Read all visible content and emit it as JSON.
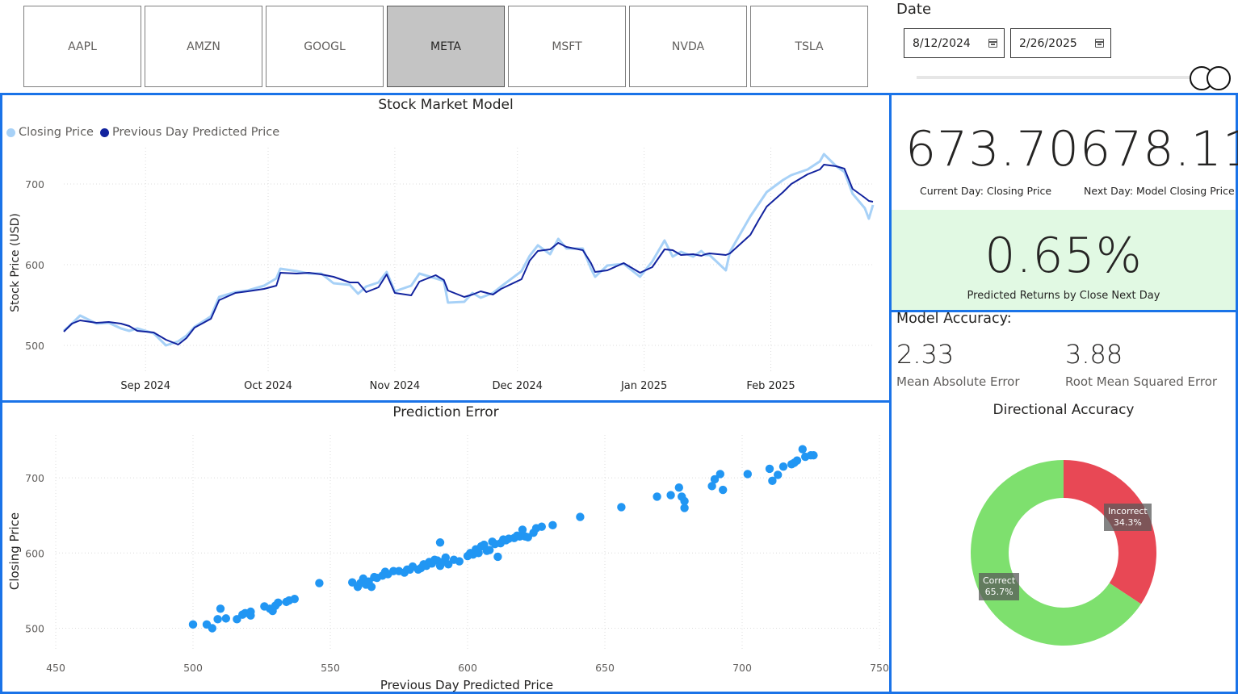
{
  "tickers": {
    "items": [
      "AAPL",
      "AMZN",
      "GOOGL",
      "META",
      "MSFT",
      "NVDA",
      "TSLA"
    ],
    "selected": "META"
  },
  "date_filter": {
    "title": "Date",
    "start": "8/12/2024",
    "end": "2/26/2025"
  },
  "kpi": {
    "current_value": "673.70",
    "current_label": "Current Day: Closing Price",
    "next_value": "678.11",
    "next_label": "Next Day: Model Closing Price",
    "returns_value": "0.65%",
    "returns_label": "Predicted Returns by Close Next Day"
  },
  "accuracy": {
    "title": "Model Accuracy:",
    "mae_value": "2.33",
    "mae_label": "Mean Absolute Error",
    "rmse_value": "3.88",
    "rmse_label": "Root Mean Squared Error"
  },
  "colors": {
    "accent": "#1a73e8",
    "closing": "#a7d1f7",
    "predicted": "#12239e",
    "scatter": "#2196f3",
    "correct": "#7ee06e",
    "incorrect": "#e84855",
    "returns_bg": "#e1f9e3"
  },
  "chart_data": [
    {
      "type": "line",
      "title": "Stock Market Model",
      "xlabel": "",
      "ylabel": "Stock Price (USD)",
      "x_tick_labels": [
        "Sep 2024",
        "Oct 2024",
        "Nov 2024",
        "Dec 2024",
        "Jan 2025",
        "Feb 2025"
      ],
      "y_ticks": [
        500,
        600,
        700
      ],
      "ylim": [
        480,
        745
      ],
      "x_range": [
        "2024-08-12",
        "2025-02-26"
      ],
      "grid": true,
      "legend_position": "top-left",
      "series": [
        {
          "name": "Closing Price",
          "points": [
            [
              "2024-08-12",
              518
            ],
            [
              "2024-08-14",
              527
            ],
            [
              "2024-08-16",
              537
            ],
            [
              "2024-08-20",
              527
            ],
            [
              "2024-08-23",
              528
            ],
            [
              "2024-08-26",
              521
            ],
            [
              "2024-08-28",
              518
            ],
            [
              "2024-08-30",
              521
            ],
            [
              "2024-09-03",
              515
            ],
            [
              "2024-09-06",
              500
            ],
            [
              "2024-09-09",
              505
            ],
            [
              "2024-09-11",
              512
            ],
            [
              "2024-09-13",
              523
            ],
            [
              "2024-09-17",
              536
            ],
            [
              "2024-09-19",
              560
            ],
            [
              "2024-09-23",
              566
            ],
            [
              "2024-09-26",
              568
            ],
            [
              "2024-09-30",
              574
            ],
            [
              "2024-10-03",
              583
            ],
            [
              "2024-10-04",
              595
            ],
            [
              "2024-10-08",
              592
            ],
            [
              "2024-10-11",
              589
            ],
            [
              "2024-10-14",
              589
            ],
            [
              "2024-10-17",
              577
            ],
            [
              "2024-10-21",
              575
            ],
            [
              "2024-10-23",
              564
            ],
            [
              "2024-10-25",
              573
            ],
            [
              "2024-10-28",
              578
            ],
            [
              "2024-10-30",
              591
            ],
            [
              "2024-11-01",
              567
            ],
            [
              "2024-11-05",
              574
            ],
            [
              "2024-11-07",
              589
            ],
            [
              "2024-11-11",
              583
            ],
            [
              "2024-11-13",
              580
            ],
            [
              "2024-11-14",
              553
            ],
            [
              "2024-11-18",
              554
            ],
            [
              "2024-11-20",
              565
            ],
            [
              "2024-11-22",
              559
            ],
            [
              "2024-11-25",
              565
            ],
            [
              "2024-11-27",
              573
            ],
            [
              "2024-12-02",
              592
            ],
            [
              "2024-12-04",
              611
            ],
            [
              "2024-12-06",
              624
            ],
            [
              "2024-12-09",
              613
            ],
            [
              "2024-12-11",
              632
            ],
            [
              "2024-12-13",
              620
            ],
            [
              "2024-12-17",
              620
            ],
            [
              "2024-12-19",
              595
            ],
            [
              "2024-12-20",
              585
            ],
            [
              "2024-12-23",
              599
            ],
            [
              "2024-12-27",
              601
            ],
            [
              "2024-12-31",
              585
            ],
            [
              "2025-01-03",
              604
            ],
            [
              "2025-01-06",
              630
            ],
            [
              "2025-01-08",
              610
            ],
            [
              "2025-01-10",
              616
            ],
            [
              "2025-01-13",
              610
            ],
            [
              "2025-01-15",
              617
            ],
            [
              "2025-01-16",
              612
            ],
            [
              "2025-01-17",
              612
            ],
            [
              "2025-01-21",
              593
            ],
            [
              "2025-01-22",
              616
            ],
            [
              "2025-01-27",
              660
            ],
            [
              "2025-01-29",
              675
            ],
            [
              "2025-01-31",
              690
            ],
            [
              "2025-02-04",
              705
            ],
            [
              "2025-02-06",
              711
            ],
            [
              "2025-02-10",
              718
            ],
            [
              "2025-02-13",
              728
            ],
            [
              "2025-02-14",
              737
            ],
            [
              "2025-02-17",
              722
            ],
            [
              "2025-02-19",
              715
            ],
            [
              "2025-02-21",
              688
            ],
            [
              "2025-02-24",
              670
            ],
            [
              "2025-02-25",
              657
            ],
            [
              "2025-02-26",
              674
            ]
          ]
        },
        {
          "name": "Previous Day Predicted Price",
          "points": [
            [
              "2024-08-12",
              517
            ],
            [
              "2024-08-14",
              527
            ],
            [
              "2024-08-16",
              531
            ],
            [
              "2024-08-20",
              528
            ],
            [
              "2024-08-23",
              529
            ],
            [
              "2024-08-26",
              527
            ],
            [
              "2024-08-28",
              524
            ],
            [
              "2024-08-30",
              518
            ],
            [
              "2024-09-03",
              516
            ],
            [
              "2024-09-06",
              507
            ],
            [
              "2024-09-09",
              501
            ],
            [
              "2024-09-11",
              509
            ],
            [
              "2024-09-13",
              522
            ],
            [
              "2024-09-17",
              533
            ],
            [
              "2024-09-19",
              556
            ],
            [
              "2024-09-23",
              565
            ],
            [
              "2024-09-26",
              567
            ],
            [
              "2024-09-30",
              570
            ],
            [
              "2024-10-03",
              574
            ],
            [
              "2024-10-04",
              590
            ],
            [
              "2024-10-08",
              589
            ],
            [
              "2024-10-11",
              590
            ],
            [
              "2024-10-14",
              588
            ],
            [
              "2024-10-17",
              585
            ],
            [
              "2024-10-21",
              578
            ],
            [
              "2024-10-23",
              578
            ],
            [
              "2024-10-25",
              566
            ],
            [
              "2024-10-28",
              572
            ],
            [
              "2024-10-30",
              588
            ],
            [
              "2024-11-01",
              565
            ],
            [
              "2024-11-05",
              562
            ],
            [
              "2024-11-07",
              579
            ],
            [
              "2024-11-11",
              587
            ],
            [
              "2024-11-13",
              581
            ],
            [
              "2024-11-14",
              568
            ],
            [
              "2024-11-18",
              560
            ],
            [
              "2024-11-20",
              563
            ],
            [
              "2024-11-22",
              567
            ],
            [
              "2024-11-25",
              563
            ],
            [
              "2024-11-27",
              570
            ],
            [
              "2024-12-02",
              582
            ],
            [
              "2024-12-04",
              605
            ],
            [
              "2024-12-06",
              617
            ],
            [
              "2024-12-09",
              619
            ],
            [
              "2024-12-11",
              627
            ],
            [
              "2024-12-13",
              622
            ],
            [
              "2024-12-17",
              618
            ],
            [
              "2024-12-19",
              602
            ],
            [
              "2024-12-20",
              591
            ],
            [
              "2024-12-23",
              593
            ],
            [
              "2024-12-27",
              602
            ],
            [
              "2024-12-31",
              590
            ],
            [
              "2025-01-03",
              597
            ],
            [
              "2025-01-06",
              619
            ],
            [
              "2025-01-08",
              618
            ],
            [
              "2025-01-10",
              612
            ],
            [
              "2025-01-13",
              613
            ],
            [
              "2025-01-15",
              611
            ],
            [
              "2025-01-16",
              613
            ],
            [
              "2025-01-17",
              614
            ],
            [
              "2025-01-21",
              612
            ],
            [
              "2025-01-22",
              614
            ],
            [
              "2025-01-27",
              637
            ],
            [
              "2025-01-29",
              655
            ],
            [
              "2025-01-31",
              672
            ],
            [
              "2025-02-04",
              690
            ],
            [
              "2025-02-06",
              700
            ],
            [
              "2025-02-10",
              712
            ],
            [
              "2025-02-13",
              718
            ],
            [
              "2025-02-14",
              724
            ],
            [
              "2025-02-17",
              722
            ],
            [
              "2025-02-19",
              719
            ],
            [
              "2025-02-21",
              694
            ],
            [
              "2025-02-24",
              683
            ],
            [
              "2025-02-25",
              679
            ],
            [
              "2025-02-26",
              678
            ]
          ]
        }
      ]
    },
    {
      "type": "scatter",
      "title": "Prediction Error",
      "xlabel": "Previous Day Predicted Price",
      "ylabel": "Closing Price",
      "xlim": [
        450,
        750
      ],
      "ylim": [
        478,
        757
      ],
      "x_ticks": [
        450,
        500,
        550,
        600,
        650,
        700,
        750
      ],
      "y_ticks": [
        500,
        600,
        700
      ],
      "grid": true,
      "points": [
        [
          500,
          505
        ],
        [
          505,
          505
        ],
        [
          507,
          500
        ],
        [
          509,
          512
        ],
        [
          510,
          526
        ],
        [
          512,
          513
        ],
        [
          516,
          512
        ],
        [
          518,
          518
        ],
        [
          519,
          520
        ],
        [
          521,
          522
        ],
        [
          521,
          517
        ],
        [
          526,
          529
        ],
        [
          528,
          526
        ],
        [
          529,
          523
        ],
        [
          530,
          530
        ],
        [
          531,
          534
        ],
        [
          534,
          535
        ],
        [
          535,
          537
        ],
        [
          537,
          539
        ],
        [
          546,
          560
        ],
        [
          558,
          561
        ],
        [
          560,
          555
        ],
        [
          561,
          560
        ],
        [
          562,
          566
        ],
        [
          563,
          558
        ],
        [
          564,
          562
        ],
        [
          565,
          555
        ],
        [
          566,
          568
        ],
        [
          567,
          567
        ],
        [
          569,
          570
        ],
        [
          570,
          575
        ],
        [
          571,
          572
        ],
        [
          573,
          576
        ],
        [
          575,
          576
        ],
        [
          577,
          574
        ],
        [
          578,
          578
        ],
        [
          579,
          578
        ],
        [
          580,
          582
        ],
        [
          582,
          578
        ],
        [
          583,
          580
        ],
        [
          584,
          585
        ],
        [
          585,
          583
        ],
        [
          586,
          588
        ],
        [
          587,
          586
        ],
        [
          588,
          591
        ],
        [
          589,
          590
        ],
        [
          590,
          614
        ],
        [
          590,
          583
        ],
        [
          591,
          588
        ],
        [
          592,
          594
        ],
        [
          593,
          585
        ],
        [
          595,
          591
        ],
        [
          597,
          589
        ],
        [
          600,
          596
        ],
        [
          601,
          600
        ],
        [
          602,
          598
        ],
        [
          603,
          605
        ],
        [
          604,
          600
        ],
        [
          605,
          609
        ],
        [
          606,
          611
        ],
        [
          607,
          603
        ],
        [
          608,
          604
        ],
        [
          609,
          615
        ],
        [
          610,
          612
        ],
        [
          611,
          595
        ],
        [
          612,
          613
        ],
        [
          613,
          618
        ],
        [
          614,
          617
        ],
        [
          615,
          619
        ],
        [
          617,
          620
        ],
        [
          618,
          623
        ],
        [
          619,
          622
        ],
        [
          620,
          631
        ],
        [
          621,
          622
        ],
        [
          622,
          621
        ],
        [
          624,
          627
        ],
        [
          625,
          633
        ],
        [
          627,
          635
        ],
        [
          631,
          637
        ],
        [
          641,
          648
        ],
        [
          656,
          661
        ],
        [
          669,
          675
        ],
        [
          674,
          677
        ],
        [
          677,
          687
        ],
        [
          678,
          675
        ],
        [
          679,
          660
        ],
        [
          679,
          669
        ],
        [
          689,
          689
        ],
        [
          690,
          698
        ],
        [
          692,
          705
        ],
        [
          693,
          684
        ],
        [
          702,
          705
        ],
        [
          710,
          712
        ],
        [
          711,
          696
        ],
        [
          713,
          704
        ],
        [
          715,
          715
        ],
        [
          718,
          718
        ],
        [
          719,
          720
        ],
        [
          720,
          723
        ],
        [
          722,
          738
        ],
        [
          723,
          728
        ],
        [
          725,
          730
        ],
        [
          726,
          730
        ]
      ]
    },
    {
      "type": "pie",
      "title": "Directional Accuracy",
      "donut": true,
      "slices": [
        {
          "label": "Incorrect",
          "value": 34.3,
          "label_text": "34.3%"
        },
        {
          "label": "Correct",
          "value": 65.7,
          "label_text": "65.7%"
        }
      ]
    }
  ]
}
